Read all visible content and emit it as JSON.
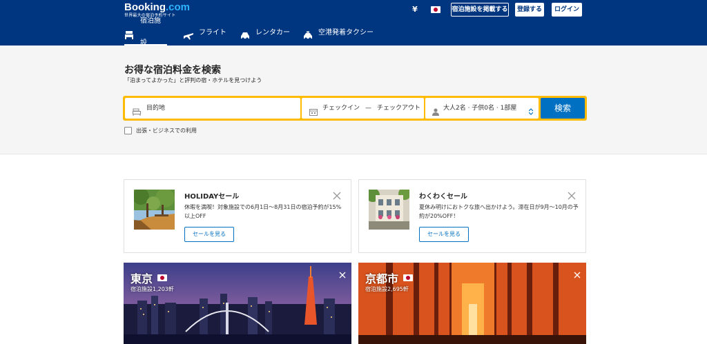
{
  "header": {
    "logo_main": "Booking",
    "logo_dot": ".com",
    "logo_sub": "世界最大の宿泊予約サイト",
    "currency": "¥",
    "list_property": "宿泊施設を掲載する",
    "register": "登録する",
    "login": "ログイン"
  },
  "nav": {
    "items": [
      {
        "label": "宿泊施設",
        "icon": "bed-icon",
        "active": true
      },
      {
        "label": "フライト",
        "icon": "plane-icon",
        "active": false
      },
      {
        "label": "レンタカー",
        "icon": "car-icon",
        "active": false
      },
      {
        "label": "空港発着タクシー",
        "icon": "taxi-icon",
        "active": false
      }
    ]
  },
  "search": {
    "title": "お得な宿泊料金を検索",
    "subtitle": "「泊まってよかった」と評判の宿・ホテルを見つけよう",
    "destination_placeholder": "目的地",
    "checkin": "チェックイン",
    "date_sep": "—",
    "checkout": "チェックアウト",
    "guests": "大人2名 · 子供0名 · 1部屋",
    "button": "検索",
    "business_label": "出張・ビジネスでの利用"
  },
  "promos": [
    {
      "title": "HOLIDAYセール",
      "desc": "休暇を満喫！対象施設での6月1日〜8月31日の宿泊予約が15%以上OFF",
      "button": "セールを見る"
    },
    {
      "title": "わくわくセール",
      "desc": "夏休み明けにおトクな旅へ出かけよう。滞在日が9月〜10月の予約が20%OFF！",
      "button": "セールを見る"
    }
  ],
  "cities": [
    {
      "name": "東京",
      "count": "宿泊施設1,203軒"
    },
    {
      "name": "京都市",
      "count": "宿泊施設2,695軒"
    }
  ],
  "colors": {
    "brand_blue": "#003580",
    "accent_blue": "#0071c2",
    "search_yellow": "#febb02"
  }
}
